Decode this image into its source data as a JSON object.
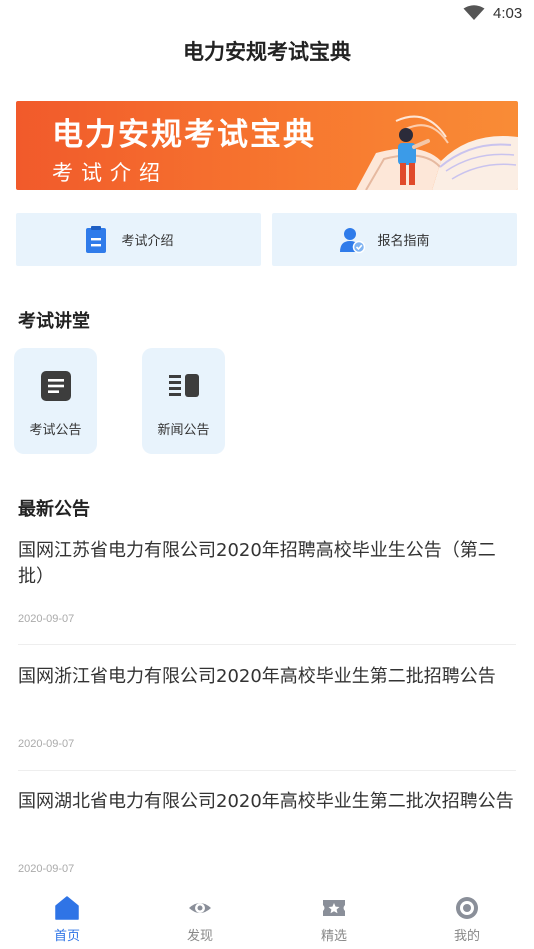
{
  "status_bar": {
    "time": "4:03"
  },
  "header": {
    "title": "电力安规考试宝典"
  },
  "banner": {
    "title": "电力安规考试宝典",
    "subtitle": "考试介绍"
  },
  "quick_actions": [
    {
      "label": "考试介绍",
      "icon": "document-icon"
    },
    {
      "label": "报名指南",
      "icon": "user-check-icon"
    }
  ],
  "lecture_section": {
    "title": "考试讲堂",
    "tiles": [
      {
        "label": "考试公告",
        "icon": "notice-list-icon"
      },
      {
        "label": "新闻公告",
        "icon": "news-columns-icon"
      }
    ]
  },
  "news_section": {
    "title": "最新公告",
    "items": [
      {
        "title": "国网江苏省电力有限公司2020年招聘高校毕业生公告（第二批）",
        "date": "2020-09-07"
      },
      {
        "title": "国网浙江省电力有限公司2020年高校毕业生第二批招聘公告",
        "date": "2020-09-07"
      },
      {
        "title": "国网湖北省电力有限公司2020年高校毕业生第二批次招聘公告",
        "date": "2020-09-07"
      }
    ]
  },
  "tabbar": {
    "active_color": "#2f74e6",
    "items": [
      {
        "label": "首页",
        "icon": "home-icon",
        "active": true
      },
      {
        "label": "发现",
        "icon": "eye-icon",
        "active": false
      },
      {
        "label": "精选",
        "icon": "star-ticket-icon",
        "active": false
      },
      {
        "label": "我的",
        "icon": "profile-target-icon",
        "active": false
      }
    ]
  }
}
